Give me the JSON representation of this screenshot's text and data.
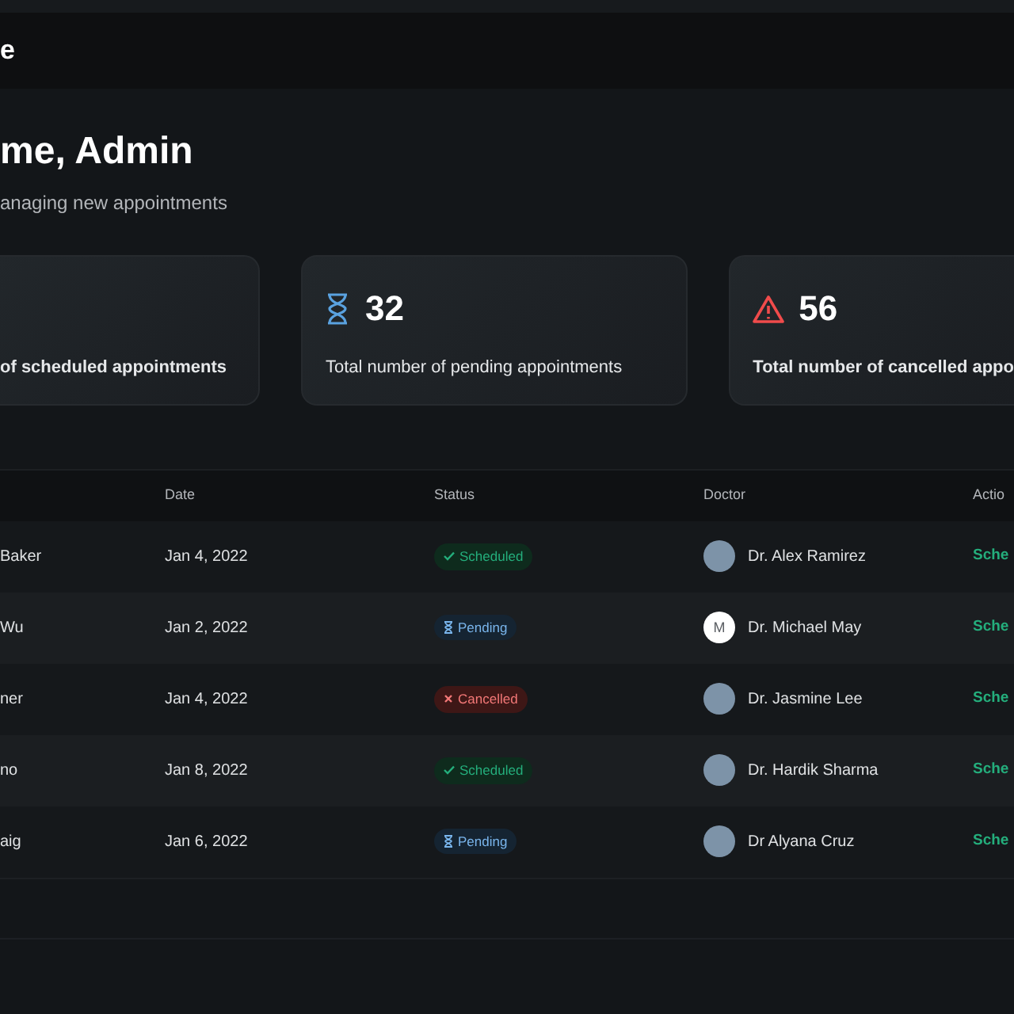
{
  "header": {
    "title": "e"
  },
  "greeting": {
    "title": "me, Admin",
    "subtitle": "anaging new appointments"
  },
  "stats": [
    {
      "label": "of  scheduled appointments",
      "bold": true
    },
    {
      "kind": "pending",
      "count": "32",
      "label": "Total number of pending appointments",
      "bold": false
    },
    {
      "kind": "cancelled",
      "count": "56",
      "label": "Total number of cancelled  appo",
      "bold": true
    }
  ],
  "table": {
    "columns": [
      "Date",
      "Status",
      "Doctor",
      "Actio"
    ],
    "rows": [
      {
        "patient": "Baker",
        "date": "Jan 4, 2022",
        "status": {
          "kind": "scheduled",
          "label": "Scheduled"
        },
        "doctor": {
          "name": "Dr. Alex Ramirez"
        },
        "action": "Sche"
      },
      {
        "patient": "Wu",
        "date": "Jan 2, 2022",
        "status": {
          "kind": "pending",
          "label": "Pending"
        },
        "doctor": {
          "name": "Dr. Michael May",
          "initial": "M"
        },
        "action": "Sche"
      },
      {
        "patient": "ner",
        "date": "Jan 4, 2022",
        "status": {
          "kind": "cancelled",
          "label": "Cancelled"
        },
        "doctor": {
          "name": "Dr. Jasmine Lee"
        },
        "action": "Sche"
      },
      {
        "patient": "no",
        "date": "Jan 8, 2022",
        "status": {
          "kind": "scheduled",
          "label": "Scheduled"
        },
        "doctor": {
          "name": "Dr. Hardik Sharma"
        },
        "action": "Sche"
      },
      {
        "patient": "aig",
        "date": "Jan 6, 2022",
        "status": {
          "kind": "pending",
          "label": "Pending"
        },
        "doctor": {
          "name": "Dr Alyana Cruz"
        },
        "action": "Sche"
      }
    ]
  }
}
